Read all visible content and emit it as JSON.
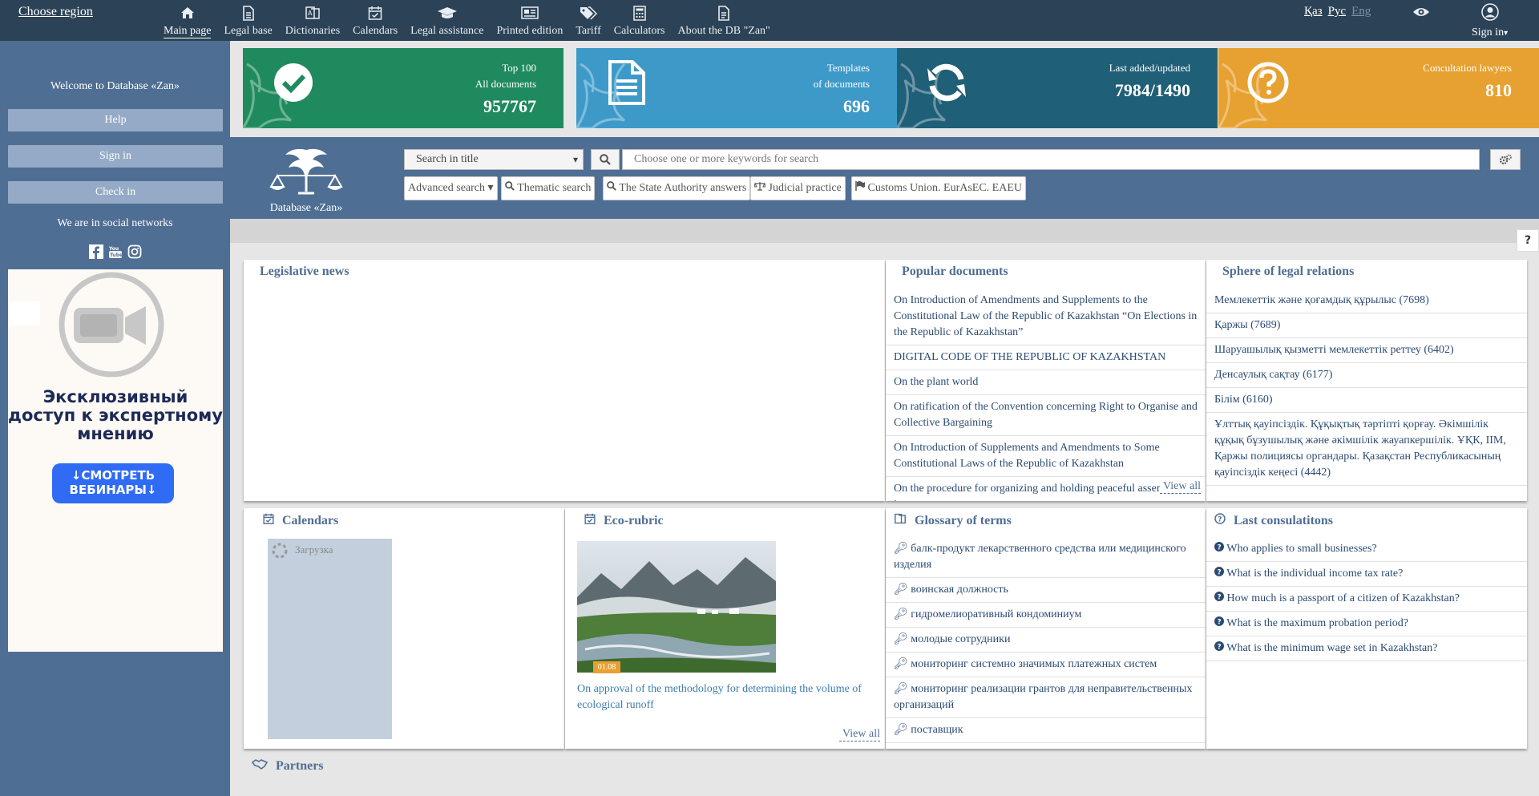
{
  "header": {
    "choose_region": "Choose region",
    "nav": [
      {
        "label": "Main page",
        "icon": "home-icon"
      },
      {
        "label": "Legal base",
        "icon": "document-icon"
      },
      {
        "label": "Dictionaries",
        "icon": "dictionary-icon"
      },
      {
        "label": "Calendars",
        "icon": "calendar-icon"
      },
      {
        "label": "Legal assistance",
        "icon": "graduation-cap-icon"
      },
      {
        "label": "Printed edition",
        "icon": "newspaper-icon"
      },
      {
        "label": "Tariff",
        "icon": "tags-icon"
      },
      {
        "label": "Calculators",
        "icon": "calculator-icon"
      },
      {
        "label": "About the DB \"Zan\"",
        "icon": "info-document-icon"
      }
    ],
    "languages": [
      "Қаз",
      "Рус",
      "Eng"
    ],
    "sign_in": "Sign in"
  },
  "sidebar": {
    "welcome": "Welcome to Database «Zan»",
    "help": "Help",
    "sign_in": "Sign in",
    "check_in": "Check in",
    "social_text": "We are in social networks",
    "ad": {
      "text": "Эксклюзивный доступ к экспертному мнению",
      "button": "↓СМОТРЕТЬ ВЕБИНАРЫ↓"
    }
  },
  "tiles": [
    {
      "line1": "Top 100",
      "line2": "All documents",
      "value": "957767",
      "color": "#1f8a5e"
    },
    {
      "line1": "Templates",
      "line2": "of documents",
      "value": "696",
      "color": "#3d9ac8"
    },
    {
      "line1": "Last added/updated",
      "line2": "",
      "value": "7984/1490",
      "color": "#1f5f77"
    },
    {
      "line1": "Concultation lawyers",
      "line2": "",
      "value": "810",
      "color": "#e7a130"
    }
  ],
  "search": {
    "logo_caption": "Database «Zan»",
    "select_value": "Search in title",
    "placeholder": "Choose one or more keywords for search",
    "chips": [
      "Advanced search",
      "Thematic search",
      "The State Authority answers",
      "Judicial practice",
      "Customs Union. EurAsEC. EAEU"
    ]
  },
  "panels": {
    "legislative_news": {
      "title": "Legislative news"
    },
    "popular": {
      "title": "Popular documents",
      "items": [
        "On Introduction of Amendments and Supplements to the Constitutional Law of the Republic of Kazakhstan “On Elections in the Republic of Kazakhstan”",
        "DIGITAL CODE OF THE REPUBLIC OF KAZAKHSTAN",
        "On the plant world",
        "On ratification of the Convention concerning Right to Organise and Collective Bargaining",
        "On Introduction of Supplements and Amendments to Some Constitutional Laws of the Republic of Kazakhstan",
        "On the procedure for organizing and holding peaceful assemblies in"
      ],
      "view_all": "View all"
    },
    "sphere": {
      "title": "Sphere of legal relations",
      "items": [
        "Мемлекеттік және қоғамдық құрылыс (7698)",
        "Қаржы (7689)",
        "Шаруашылық қызметті мемлекеттік реттеу (6402)",
        "Денсаулық сақтау (6177)",
        "Білім (6160)",
        "Ұлттық қауіпсіздік. Құқықтық тәртіпті қорғау. Әкімшілік құқық бұзушылық және әкімшілік жауапкершілік. ҰҚК, ІІМ, Қаржы полициясы органдары. Қазақстан Республикасының қауіпсіздік кеңесі (4442)"
      ]
    },
    "calendars": {
      "title": "Calendars",
      "loading": "Загрузка"
    },
    "eco": {
      "title": "Eco-rubric",
      "date": "01.08",
      "link": "On approval of the methodology for determining the volume of ecological runoff",
      "view_all": "View all"
    },
    "glossary": {
      "title": "Glossary of terms",
      "items": [
        "балк-продукт лекарственного средства или медицинского изделия",
        "воинская должность",
        "гидромелиоративный кондоминиум",
        "молодые сотрудники",
        "мониторинг системно значимых платежных систем",
        "мониторинг реализации грантов для неправительственных организаций",
        "поставщик"
      ]
    },
    "consultations": {
      "title": "Last consulatitons",
      "items": [
        "Who applies to small businesses?",
        "What is the individual income tax rate?",
        "How much is a passport of a citizen of Kazakhstan?",
        "What is the maximum probation period?",
        "What is the minimum wage set in Kazakhstan?"
      ]
    },
    "partners": {
      "title": "Partners"
    }
  }
}
